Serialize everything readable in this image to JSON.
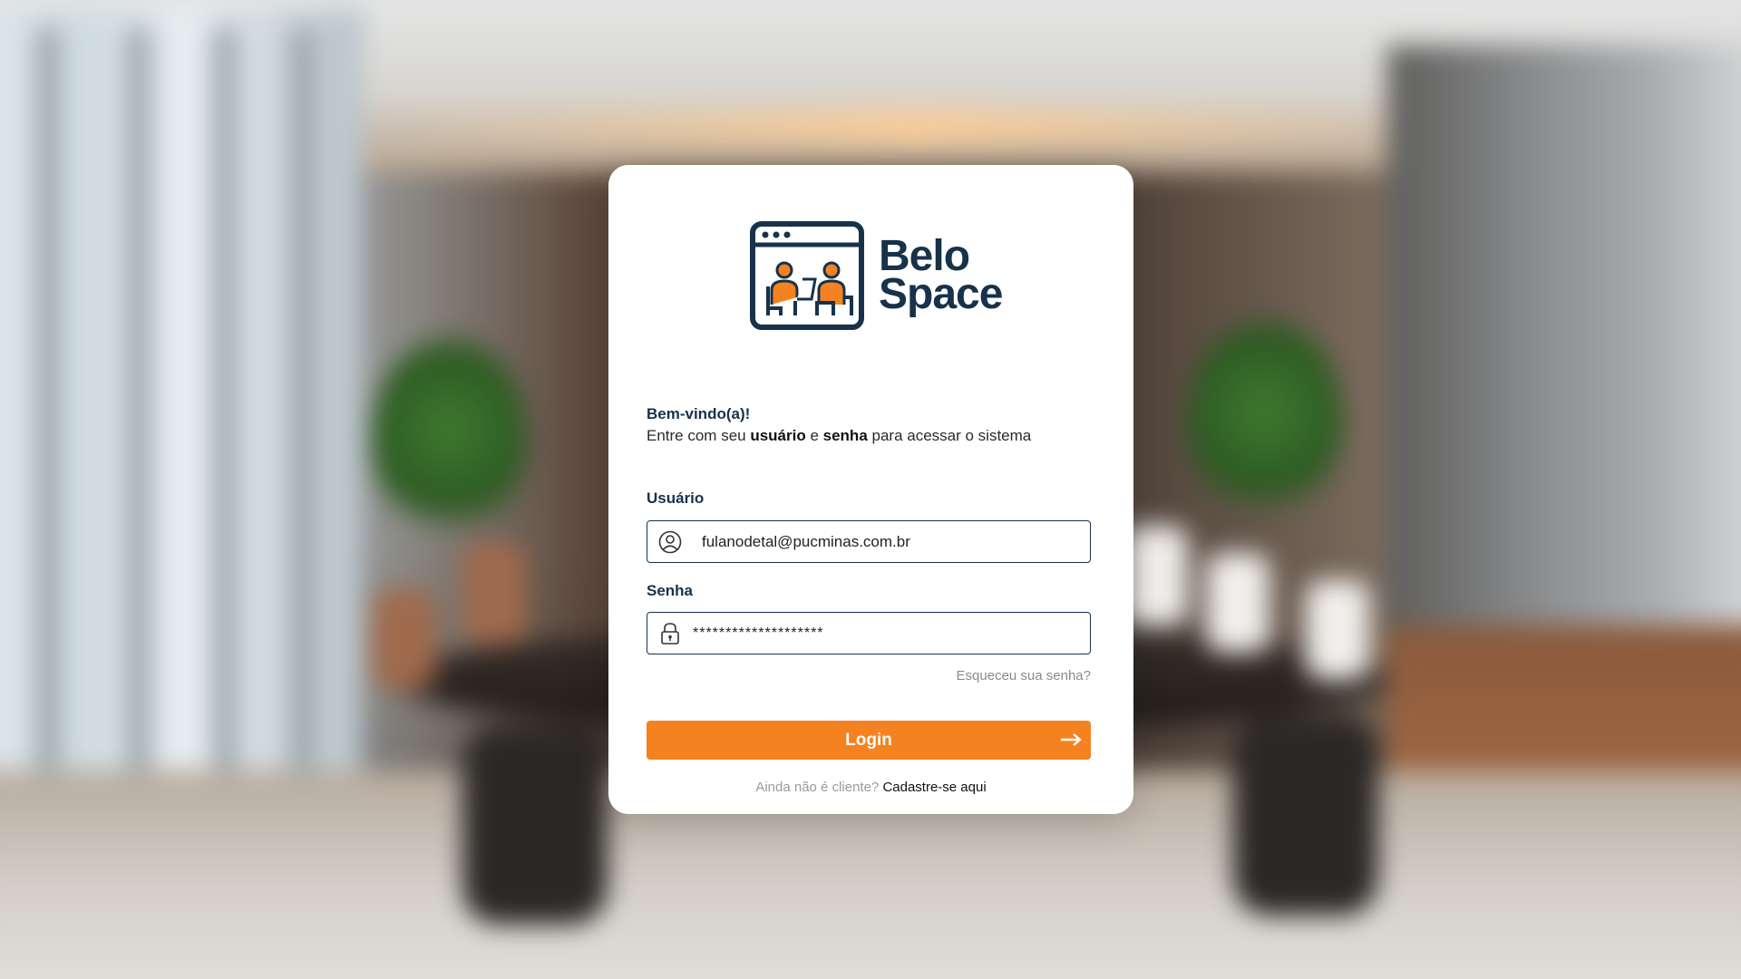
{
  "brand": {
    "name_line1": "Belo",
    "name_line2": "Space",
    "navy": "#17324a",
    "orange": "#f58220"
  },
  "welcome": {
    "title": "Bem-vindo(a)!",
    "text_before": "Entre com seu ",
    "user_word": "usuário",
    "text_mid": " e ",
    "pass_word": "senha",
    "text_after": " para acessar o sistema"
  },
  "form": {
    "user_label": "Usuário",
    "user_value": "fulanodetal@pucminas.com.br",
    "user_icon": "user-circle-icon",
    "pass_label": "Senha",
    "pass_value": "********************",
    "pass_icon": "lock-icon",
    "forgot_link": "Esqueceu sua senha?",
    "login_button": "Login",
    "login_icon": "arrow-right-icon"
  },
  "signup": {
    "prompt": "Ainda não é cliente?",
    "link": "Cadastre-se aqui"
  }
}
